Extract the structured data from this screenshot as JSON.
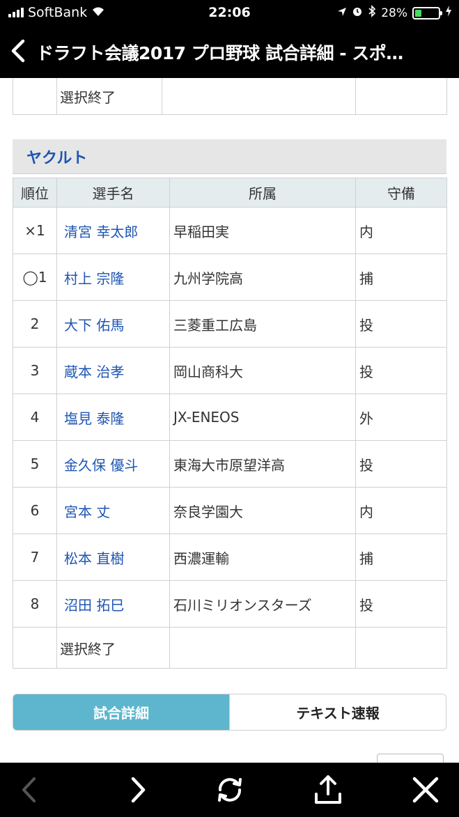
{
  "status_bar": {
    "carrier": "SoftBank",
    "time": "22:06",
    "battery": "28%",
    "battery_level": 0.28,
    "icons": [
      "signal-icon",
      "wifi-icon",
      "location-icon",
      "alarm-icon",
      "bluetooth-icon",
      "battery-icon",
      "charging-icon"
    ]
  },
  "nav": {
    "title": "ドラフト会議2017 プロ野球 試合詳細 - スポ…",
    "back_icon": "chevron-left-icon"
  },
  "prev_table_tail": {
    "rank": "",
    "name": "選択終了",
    "affiliation": "",
    "position": ""
  },
  "team": {
    "name": "ヤクルト",
    "headers": {
      "rank": "順位",
      "name": "選手名",
      "affiliation": "所属",
      "position": "守備"
    },
    "rows": [
      {
        "rank": "×1",
        "name": "清宮 幸太郎",
        "affiliation": "早稲田実",
        "position": "内"
      },
      {
        "rank": "◯1",
        "name": "村上 宗隆",
        "affiliation": "九州学院高",
        "position": "捕"
      },
      {
        "rank": "2",
        "name": "大下 佑馬",
        "affiliation": "三菱重工広島",
        "position": "投"
      },
      {
        "rank": "3",
        "name": "蔵本 治孝",
        "affiliation": "岡山商科大",
        "position": "投"
      },
      {
        "rank": "4",
        "name": "塩見 泰隆",
        "affiliation": "JX-ENEOS",
        "position": "外"
      },
      {
        "rank": "5",
        "name": "金久保 優斗",
        "affiliation": "東海大市原望洋高",
        "position": "投"
      },
      {
        "rank": "6",
        "name": "宮本 丈",
        "affiliation": "奈良学園大",
        "position": "内"
      },
      {
        "rank": "7",
        "name": "松本 直樹",
        "affiliation": "西濃運輸",
        "position": "捕"
      },
      {
        "rank": "8",
        "name": "沼田 拓巳",
        "affiliation": "石川ミリオンスターズ",
        "position": "投"
      }
    ],
    "final_row": {
      "name": "選択終了"
    }
  },
  "tabs": [
    {
      "label": "試合詳細",
      "active": true
    },
    {
      "label": "テキスト速報",
      "active": false
    }
  ],
  "colors": {
    "link": "#1e55b3",
    "tab_active": "#5db6cd",
    "header_bg": "#e4eced",
    "team_bar": "#e6e6e6"
  },
  "toolbar": {
    "icons": [
      "back-arrow-icon",
      "forward-arrow-icon",
      "reload-icon",
      "share-icon",
      "close-icon"
    ]
  }
}
